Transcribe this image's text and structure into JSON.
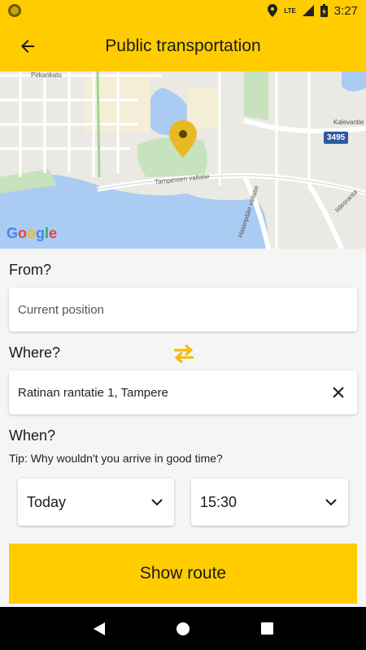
{
  "status_bar": {
    "time": "3:27",
    "network": "LTE",
    "icons": [
      "app-notification-icon",
      "location-icon",
      "signal-icon",
      "battery-icon"
    ]
  },
  "app_bar": {
    "title": "Public transportation",
    "back_icon": "arrow-back-icon"
  },
  "map": {
    "labels": {
      "pirkankatu": "Pirkankatu",
      "tampereen_valtatie": "Tampereen valtatie",
      "hatanpaan_valtatie": "Hatanpään valtatie",
      "kalevantie": "Kalevantie",
      "iidesranta": "Iidesranta"
    },
    "route_badge": "3495",
    "attribution": "Google",
    "pin_color": "#e8b923"
  },
  "form": {
    "from_label": "From?",
    "from_placeholder": "Current position",
    "where_label": "Where?",
    "where_value": "Ratinan rantatie 1, Tampere",
    "swap_icon": "swap-arrows-icon",
    "clear_icon": "close-icon",
    "when_label": "When?",
    "tip": "Tip: Why wouldn't you arrive in good time?",
    "day_select": "Today",
    "time_select": "15:30",
    "submit_label": "Show route"
  },
  "nav_bar": {
    "back": "nav-back-icon",
    "home": "nav-home-icon",
    "recents": "nav-recents-icon"
  },
  "colors": {
    "accent": "#ffcc00",
    "swap_icon": "#f5b800",
    "nav_background": "#000000"
  }
}
